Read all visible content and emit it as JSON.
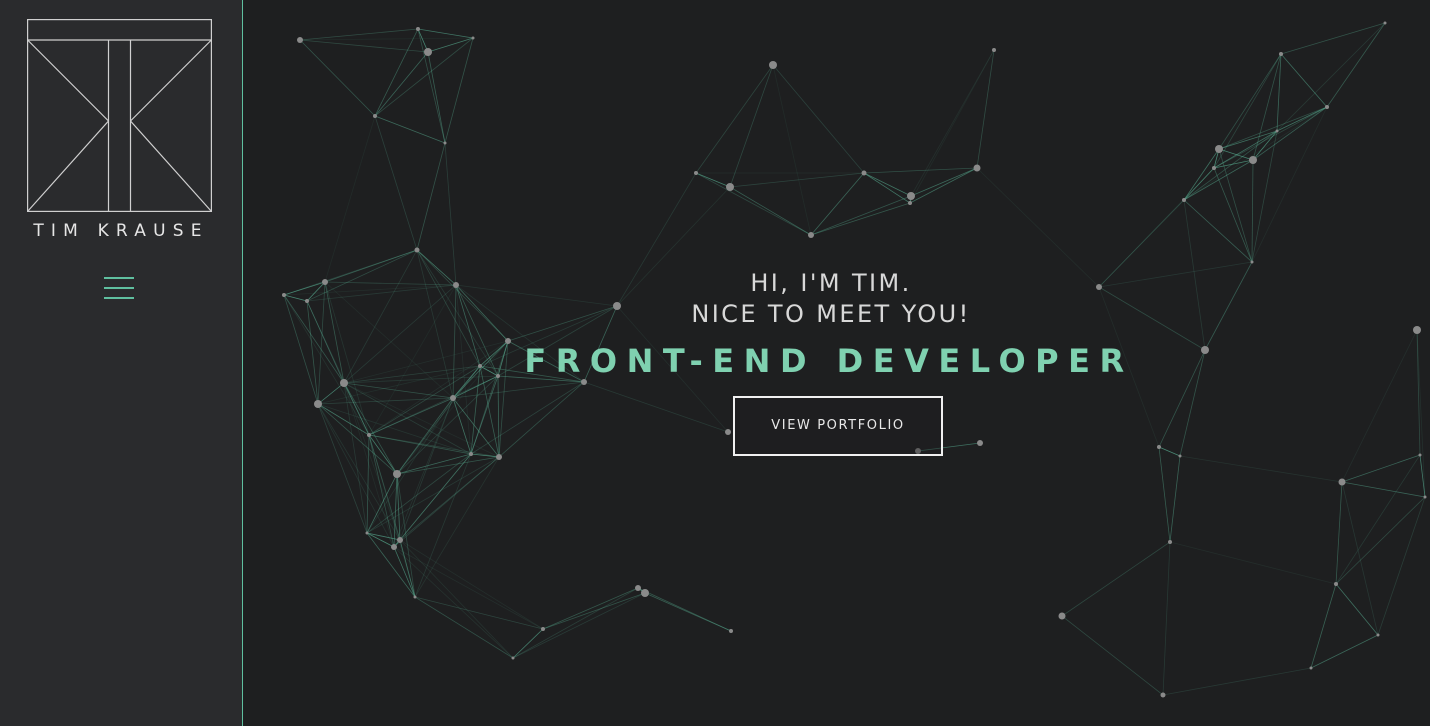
{
  "sidebar": {
    "logo_text": "TIM KRAUSE",
    "menu_icon": "hamburger-icon",
    "border_color": "#5fbf9f"
  },
  "hero": {
    "greeting_line1": "HI, I'M TIM.",
    "greeting_line2": "NICE TO MEET YOU!",
    "role": "FRONT-END DEVELOPER",
    "cta_label": "VIEW PORTFOLIO"
  },
  "colors": {
    "background": "#1e1f20",
    "sidebar": "#2a2b2d",
    "accent": "#7fd1b0",
    "network_line": "#5fbf9f",
    "network_node": "#8a8a8a"
  },
  "background_graphic": {
    "type": "particle-network",
    "description_icon": "network-graph"
  }
}
